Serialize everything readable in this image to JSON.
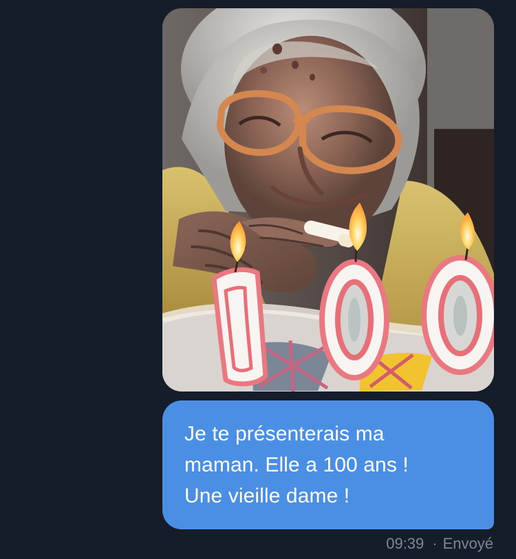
{
  "conversation": {
    "media": {
      "alt": "",
      "candles_number": "100"
    },
    "message": {
      "line_1": "Je te présenterais ma",
      "line_2": "maman. Elle a 100 ans !",
      "line_3": "Une vieille dame !"
    },
    "status": {
      "time": "09:39",
      "separator": "·",
      "state": "Envoyé"
    }
  },
  "colors": {
    "background": "#151d2b",
    "bubble": "#4a8fe4",
    "meta_text": "#7b8796"
  }
}
